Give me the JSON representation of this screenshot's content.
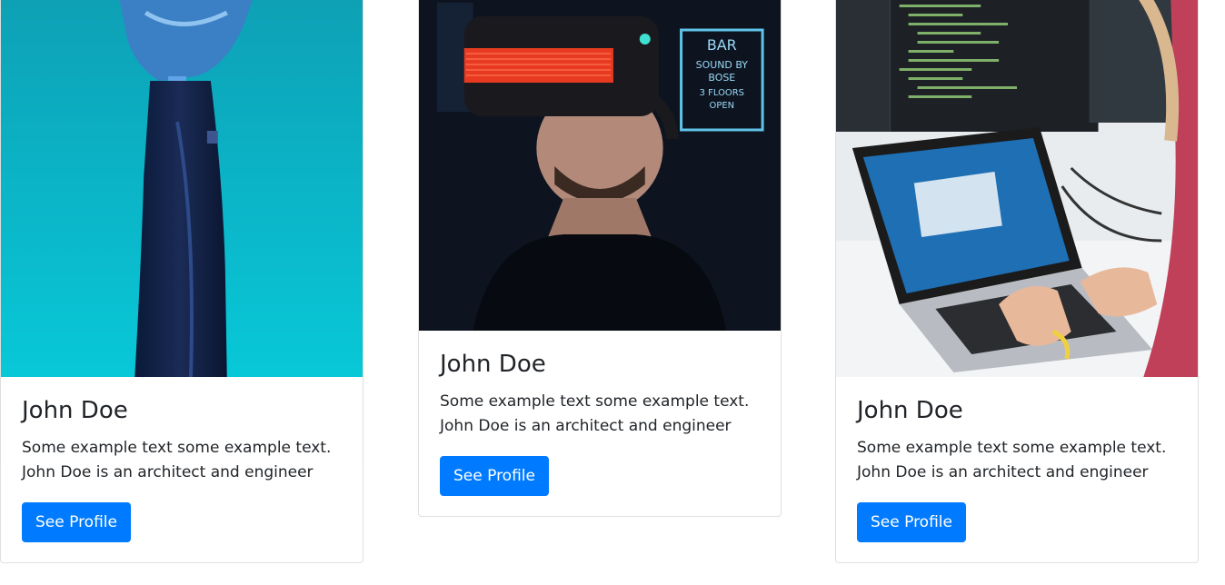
{
  "cards": [
    {
      "image": "bionic-arm-photo",
      "title": "John Doe",
      "text": "Some example text some example text. John Doe is an architect and engineer",
      "button_label": "See Profile"
    },
    {
      "image": "vr-headset-photo",
      "title": "John Doe",
      "text": "Some example text some example text. John Doe is an architect and engineer",
      "button_label": "See Profile"
    },
    {
      "image": "laptop-coding-photo",
      "title": "John Doe",
      "text": "Some example text some example text. John Doe is an architect and engineer",
      "button_label": "See Profile"
    }
  ],
  "colors": {
    "button_bg": "#007bff",
    "button_text": "#ffffff",
    "card_border": "rgba(0,0,0,0.125)",
    "teal_bg": "#0fb4c4"
  }
}
